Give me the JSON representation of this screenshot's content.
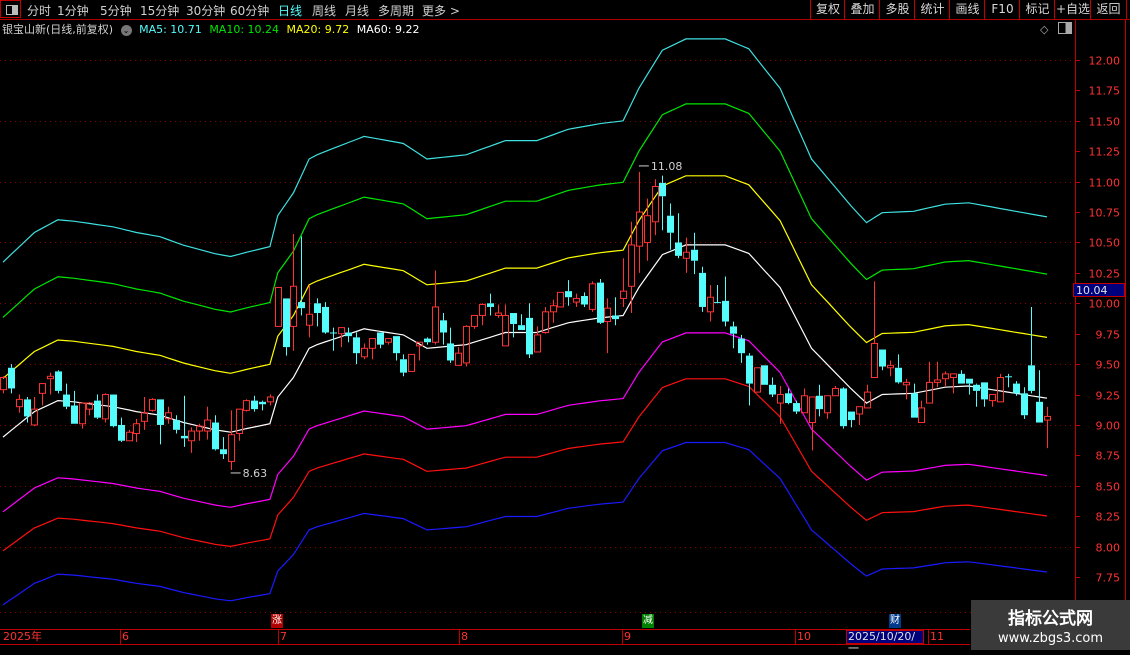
{
  "toolbar": {
    "tabs": [
      "分时",
      "1分钟",
      "5分钟",
      "15分钟",
      "30分钟",
      "60分钟",
      "日线",
      "周线",
      "月线",
      "多周期",
      "更多 >"
    ],
    "active_tab": "日线",
    "right_buttons": [
      "复权",
      "叠加",
      "多股",
      "统计",
      "画线",
      "F10",
      "标记",
      "+自选",
      "返回"
    ]
  },
  "info": {
    "title": "银宝山新(日线,前复权)",
    "dropdown_icon": "chevron-down-icon",
    "ma5": "MA5: 10.71",
    "ma10": "MA10: 10.24",
    "ma20": "MA20: 9.72",
    "ma60": "MA60: 9.22"
  },
  "axis": {
    "price_tag": "10.04"
  },
  "dates": {
    "labels": [
      "2025年",
      "6",
      "7",
      "8",
      "9",
      "10",
      "11"
    ],
    "cursor": "2025/10/20/一"
  },
  "markers": [
    {
      "text": "涨",
      "color": "#b00000"
    },
    {
      "text": "减",
      "color": "#008000"
    },
    {
      "text": "财",
      "color": "#003a8c"
    }
  ],
  "watermark": {
    "title": "指标公式网",
    "url": "www.zbgs3.com"
  },
  "chart_data": {
    "type": "candlestick",
    "ylim": [
      7.6,
      12.15
    ],
    "yticks": [
      "12.00",
      "11.75",
      "11.50",
      "11.25",
      "11.00",
      "10.75",
      "10.50",
      "10.25",
      "10.00",
      "9.75",
      "9.50",
      "9.25",
      "9.00",
      "8.75",
      "8.50",
      "8.25",
      "8.00",
      "7.75"
    ],
    "grid": "dotted every 0.50",
    "colors": {
      "up": "#ff3232",
      "down": "#54fcfc",
      "background": "#000000",
      "axis": "#ff3232"
    },
    "annotations": [
      {
        "text": "8.63",
        "bar": 29,
        "price": 8.63
      },
      {
        "text": "11.08",
        "bar": 81,
        "price": 11.08
      }
    ],
    "candles_ohlc": [
      [
        9.29,
        9.4,
        9.26,
        9.39
      ],
      [
        9.47,
        9.5,
        9.26,
        9.3
      ],
      [
        9.15,
        9.25,
        9.1,
        9.21
      ],
      [
        9.21,
        9.23,
        9.02,
        9.07
      ],
      [
        9.0,
        9.23,
        8.99,
        9.13
      ],
      [
        9.26,
        9.34,
        9.16,
        9.34
      ],
      [
        9.38,
        9.43,
        9.25,
        9.4
      ],
      [
        9.44,
        9.45,
        9.26,
        9.28
      ],
      [
        9.25,
        9.34,
        9.13,
        9.15
      ],
      [
        9.16,
        9.28,
        9.01,
        9.01
      ],
      [
        9.01,
        9.18,
        8.97,
        9.18
      ],
      [
        9.13,
        9.19,
        9.08,
        9.18
      ],
      [
        9.2,
        9.25,
        9.05,
        9.06
      ],
      [
        9.05,
        9.26,
        9.02,
        9.25
      ],
      [
        9.25,
        9.25,
        8.98,
        8.99
      ],
      [
        9.0,
        9.06,
        8.86,
        8.87
      ],
      [
        8.87,
        8.96,
        8.87,
        8.94
      ],
      [
        8.93,
        9.05,
        8.86,
        9.01
      ],
      [
        9.03,
        9.23,
        8.96,
        9.1
      ],
      [
        9.12,
        9.22,
        9.11,
        9.21
      ],
      [
        9.21,
        9.21,
        8.84,
        9.0
      ],
      [
        9.05,
        9.15,
        9.01,
        9.1
      ],
      [
        9.04,
        9.08,
        8.93,
        8.96
      ],
      [
        8.91,
        9.24,
        8.82,
        8.89
      ],
      [
        8.87,
        8.98,
        8.77,
        8.95
      ],
      [
        8.95,
        9.01,
        8.87,
        8.99
      ],
      [
        8.95,
        9.15,
        8.88,
        9.04
      ],
      [
        9.02,
        9.08,
        8.79,
        8.8
      ],
      [
        8.8,
        8.9,
        8.72,
        8.76
      ],
      [
        8.7,
        9.12,
        8.63,
        8.92
      ],
      [
        8.93,
        9.13,
        8.87,
        9.13
      ],
      [
        9.12,
        9.21,
        9.11,
        9.2
      ],
      [
        9.2,
        9.24,
        9.11,
        9.13
      ],
      [
        9.19,
        9.2,
        9.12,
        9.17
      ],
      [
        9.19,
        9.25,
        9.16,
        9.23
      ],
      [
        9.81,
        10.13,
        9.81,
        10.13
      ],
      [
        10.04,
        10.04,
        9.57,
        9.64
      ],
      [
        9.81,
        10.57,
        9.61,
        10.14
      ],
      [
        10.01,
        10.55,
        9.9,
        9.96
      ],
      [
        9.82,
        10.15,
        9.72,
        9.91
      ],
      [
        10.0,
        10.04,
        9.81,
        9.92
      ],
      [
        9.97,
        10.01,
        9.75,
        9.76
      ],
      [
        9.76,
        9.8,
        9.61,
        9.76
      ],
      [
        9.75,
        9.8,
        9.64,
        9.8
      ],
      [
        9.76,
        9.8,
        9.68,
        9.73
      ],
      [
        9.72,
        9.76,
        9.5,
        9.59
      ],
      [
        9.56,
        9.67,
        9.54,
        9.63
      ],
      [
        9.63,
        9.71,
        9.54,
        9.71
      ],
      [
        9.76,
        9.76,
        9.63,
        9.66
      ],
      [
        9.68,
        9.71,
        9.66,
        9.71
      ],
      [
        9.73,
        9.73,
        9.53,
        9.59
      ],
      [
        9.54,
        9.58,
        9.4,
        9.43
      ],
      [
        9.44,
        9.58,
        9.44,
        9.58
      ],
      [
        9.65,
        9.68,
        9.53,
        9.68
      ],
      [
        9.71,
        9.72,
        9.66,
        9.68
      ],
      [
        9.68,
        10.27,
        9.66,
        9.97
      ],
      [
        9.86,
        9.92,
        9.66,
        9.76
      ],
      [
        9.67,
        9.8,
        9.51,
        9.53
      ],
      [
        9.49,
        9.64,
        9.49,
        9.59
      ],
      [
        9.51,
        9.82,
        9.48,
        9.81
      ],
      [
        9.81,
        9.9,
        9.79,
        9.9
      ],
      [
        9.9,
        10.0,
        9.82,
        9.99
      ],
      [
        10.0,
        10.08,
        9.9,
        9.97
      ],
      [
        9.9,
        9.99,
        9.88,
        9.92
      ],
      [
        9.65,
        9.99,
        9.65,
        9.9
      ],
      [
        9.92,
        9.92,
        9.72,
        9.83
      ],
      [
        9.82,
        9.91,
        9.78,
        9.78
      ],
      [
        9.88,
        10.0,
        9.55,
        9.58
      ],
      [
        9.6,
        9.81,
        9.6,
        9.74
      ],
      [
        9.76,
        9.97,
        9.75,
        9.93
      ],
      [
        9.93,
        10.03,
        9.84,
        9.98
      ],
      [
        9.97,
        10.09,
        9.97,
        10.09
      ],
      [
        10.1,
        10.19,
        9.98,
        10.05
      ],
      [
        10.01,
        10.08,
        9.97,
        10.04
      ],
      [
        10.06,
        10.09,
        9.97,
        9.99
      ],
      [
        9.95,
        10.18,
        9.93,
        10.16
      ],
      [
        10.17,
        10.2,
        9.83,
        9.84
      ],
      [
        9.85,
        10.04,
        9.59,
        9.96
      ],
      [
        9.9,
        10.05,
        9.82,
        9.87
      ],
      [
        10.04,
        10.37,
        9.97,
        10.1
      ],
      [
        10.14,
        10.67,
        9.92,
        10.48
      ],
      [
        10.47,
        11.08,
        10.25,
        10.75
      ],
      [
        10.5,
        10.86,
        10.35,
        10.72
      ],
      [
        10.67,
        11.02,
        10.56,
        10.96
      ],
      [
        10.99,
        11.05,
        10.6,
        10.88
      ],
      [
        10.72,
        10.82,
        10.44,
        10.58
      ],
      [
        10.5,
        10.74,
        10.37,
        10.39
      ],
      [
        10.37,
        10.54,
        10.25,
        10.42
      ],
      [
        10.44,
        10.58,
        10.24,
        10.35
      ],
      [
        10.25,
        10.3,
        9.93,
        9.97
      ],
      [
        9.93,
        10.15,
        9.85,
        10.05
      ],
      [
        10.01,
        10.15,
        10.0,
        10.01
      ],
      [
        10.02,
        10.22,
        9.81,
        9.85
      ],
      [
        9.81,
        9.85,
        9.63,
        9.75
      ],
      [
        9.71,
        9.74,
        9.51,
        9.59
      ],
      [
        9.57,
        9.59,
        9.16,
        9.34
      ],
      [
        9.27,
        9.47,
        9.27,
        9.47
      ],
      [
        9.49,
        9.49,
        9.33,
        9.33
      ],
      [
        9.33,
        9.39,
        9.23,
        9.25
      ],
      [
        9.18,
        9.32,
        9.01,
        9.25
      ],
      [
        9.26,
        9.3,
        9.17,
        9.18
      ],
      [
        9.18,
        9.2,
        9.09,
        9.11
      ],
      [
        9.1,
        9.3,
        9.1,
        9.24
      ],
      [
        9.02,
        9.23,
        8.79,
        9.23
      ],
      [
        9.24,
        9.33,
        9.07,
        9.13
      ],
      [
        9.1,
        9.24,
        9.05,
        9.24
      ],
      [
        9.24,
        9.32,
        9.24,
        9.3
      ],
      [
        9.3,
        9.31,
        8.97,
        8.99
      ],
      [
        9.11,
        9.11,
        8.98,
        9.04
      ],
      [
        9.09,
        9.15,
        9.0,
        9.15
      ],
      [
        9.14,
        9.33,
        9.14,
        9.27
      ],
      [
        9.39,
        10.18,
        9.39,
        9.67
      ],
      [
        9.62,
        9.62,
        9.45,
        9.48
      ],
      [
        9.47,
        9.53,
        9.4,
        9.49
      ],
      [
        9.47,
        9.58,
        9.34,
        9.35
      ],
      [
        9.33,
        9.38,
        9.21,
        9.35
      ],
      [
        9.26,
        9.34,
        9.06,
        9.06
      ],
      [
        9.02,
        9.2,
        9.02,
        9.14
      ],
      [
        9.18,
        9.52,
        9.18,
        9.35
      ],
      [
        9.35,
        9.52,
        9.31,
        9.37
      ],
      [
        9.38,
        9.44,
        9.32,
        9.42
      ],
      [
        9.39,
        9.42,
        9.26,
        9.42
      ],
      [
        9.42,
        9.45,
        9.34,
        9.34
      ],
      [
        9.38,
        9.38,
        9.25,
        9.34
      ],
      [
        9.33,
        9.34,
        9.15,
        9.28
      ],
      [
        9.35,
        9.35,
        9.15,
        9.21
      ],
      [
        9.2,
        9.25,
        9.15,
        9.25
      ],
      [
        9.19,
        9.42,
        9.19,
        9.39
      ],
      [
        9.4,
        9.42,
        9.31,
        9.4
      ],
      [
        9.34,
        9.36,
        9.24,
        9.26
      ],
      [
        9.26,
        9.31,
        9.05,
        9.08
      ],
      [
        9.49,
        9.97,
        9.26,
        9.28
      ],
      [
        9.19,
        9.45,
        9.02,
        9.02
      ],
      [
        9.04,
        9.15,
        8.81,
        9.07
      ]
    ],
    "center_line": {
      "name": "MA60",
      "color": "#ffffff",
      "points_bar_value": [
        [
          0,
          8.9
        ],
        [
          4,
          9.11
        ],
        [
          7,
          9.2
        ],
        [
          9,
          9.19
        ],
        [
          14,
          9.15
        ],
        [
          17,
          9.11
        ],
        [
          20,
          9.08
        ],
        [
          23,
          9.02
        ],
        [
          27,
          8.96
        ],
        [
          29,
          8.94
        ],
        [
          31,
          8.97
        ],
        [
          34,
          9.01
        ],
        [
          35,
          9.23
        ],
        [
          37,
          9.39
        ],
        [
          39,
          9.63
        ],
        [
          40,
          9.66
        ],
        [
          46,
          9.79
        ],
        [
          51,
          9.74
        ],
        [
          54,
          9.63
        ],
        [
          59,
          9.66
        ],
        [
          64,
          9.76
        ],
        [
          68,
          9.76
        ],
        [
          72,
          9.84
        ],
        [
          76,
          9.88
        ],
        [
          79,
          9.9
        ],
        [
          81,
          10.13
        ],
        [
          84,
          10.4
        ],
        [
          87,
          10.48
        ],
        [
          92,
          10.48
        ],
        [
          95,
          10.41
        ],
        [
          99,
          10.13
        ],
        [
          103,
          9.63
        ],
        [
          108,
          9.3
        ],
        [
          110,
          9.18
        ],
        [
          112,
          9.25
        ],
        [
          116,
          9.26
        ],
        [
          120,
          9.31
        ],
        [
          123,
          9.32
        ],
        [
          129,
          9.26
        ],
        [
          133,
          9.22
        ]
      ]
    },
    "bands": [
      {
        "name": "MA5",
        "color": "#3ee0e0",
        "ratio": 1.1616
      },
      {
        "name": "MA10",
        "color": "#00e600",
        "ratio": 1.1106
      },
      {
        "name": "MA20",
        "color": "#ffff00",
        "ratio": 1.0542
      },
      {
        "color": "#ff00ff",
        "ratio": 0.931
      },
      {
        "color": "#ff1010",
        "ratio": 0.895
      },
      {
        "color": "#1a1aff",
        "ratio": 0.845
      }
    ]
  }
}
